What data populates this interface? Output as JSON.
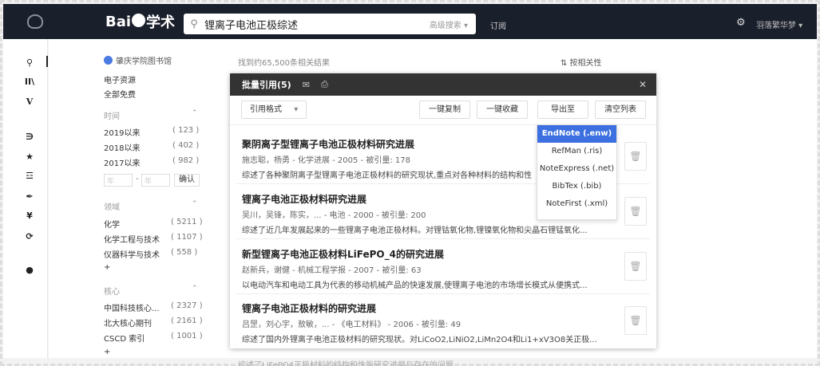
{
  "top": {
    "logo": "Bai学术",
    "search_value": "锂离子电池正极综述",
    "advanced": "高级搜索 ▾",
    "subscribe": "订阅",
    "user": "羽落繁华梦 ▾"
  },
  "sidebar": {
    "library": "肇庆学院图书馆",
    "resources": [
      "电子资源",
      "全部免费"
    ],
    "time": {
      "header": "时间",
      "items": [
        {
          "label": "2019以来",
          "count": "( 123 )"
        },
        {
          "label": "2018以来",
          "count": "( 402 )"
        },
        {
          "label": "2017以来",
          "count": "( 982 )"
        }
      ],
      "from_placeholder": "年",
      "to_placeholder": "年",
      "dash": "-",
      "confirm": "确认"
    },
    "field": {
      "header": "领域",
      "items": [
        {
          "label": "化学",
          "count": "( 5211 )"
        },
        {
          "label": "化学工程与技术",
          "count": "( 1107 )"
        },
        {
          "label": "仪器科学与技术",
          "count": "( 558 )"
        }
      ],
      "more": "+"
    },
    "core": {
      "header": "核心",
      "items": [
        {
          "label": "中国科技核心...",
          "count": "( 2327 )"
        },
        {
          "label": "北大核心期刊",
          "count": "( 2161 )"
        },
        {
          "label": "CSCD 索引",
          "count": "( 1001 )"
        }
      ],
      "more": "+"
    }
  },
  "results": {
    "count": "找到约65,500条相关结果",
    "sort": "⇅ 按相关性",
    "below": "综述了LiFePO4正极材料的结构和性能研究进展与存在的问题..."
  },
  "modal": {
    "title": "批量引用(5)",
    "close": "✕",
    "format": "引用格式",
    "format_caret": "▾",
    "copy": "一键复制",
    "collect": "一键收藏",
    "export": "导出至",
    "clear": "清空列表",
    "items": [
      {
        "title": "聚阴离子型锂离子电池正极材料研究进展",
        "meta": "施志聪，杨勇 - 化学进展 - 2005 - 被引量: 178",
        "desc": "综述了各种聚阴离子型锂离子电池正极材料的研究现状,重点对各种材料的结构和性"
      },
      {
        "title": "锂离子电池正极材料研究进展",
        "meta": "吴川，吴锋，陈实，... - 电池 - 2000 - 被引量: 200",
        "desc": "综述了近几年发展起来的一些锂离子电池正极材料。对锂钴氧化物,锂镍氧化物和尖晶石锂锰氧化..."
      },
      {
        "title": "新型锂离子电池正极材料LiFePO_4的研究进展",
        "meta": "赵新兵，谢健 - 机械工程学报 - 2007 - 被引量: 63",
        "desc": "以电动汽车和电动工具为代表的移动机械产品的快速发展,使锂离子电池的市场增长模式从便携式..."
      },
      {
        "title": "锂离子电池正极材料的研究进展",
        "meta": "吕罡，刘心宇，敖敏，... - 《电工材料》 - 2006 - 被引量: 49",
        "desc": "综述了国内外锂离子电池正极材料的研究现状。对LiCoO2,LiNiO2,LiMn2O4和Li1+xV3O8关正极..."
      }
    ]
  },
  "export_menu": [
    "EndNote (.enw)",
    "RefMan (.ris)",
    "NoteExpress (.net)",
    "BibTex (.bib)",
    "NoteFirst (.xml)"
  ],
  "icons": {
    "search": "search-icon",
    "bookshelf": "bookshelf-icon",
    "v": "v-icon",
    "rss": "rss-icon",
    "star": "star-icon",
    "layers": "layers-icon",
    "pen": "pen-icon",
    "yen": "yen-icon",
    "refresh": "refresh-icon",
    "user": "user-icon",
    "trash": "trash-icon",
    "mail": "mail-icon",
    "print": "print-icon",
    "gear": "gear-icon"
  },
  "colors": {
    "topbar": "#1a1f2c",
    "accent": "#3c6fe0"
  }
}
